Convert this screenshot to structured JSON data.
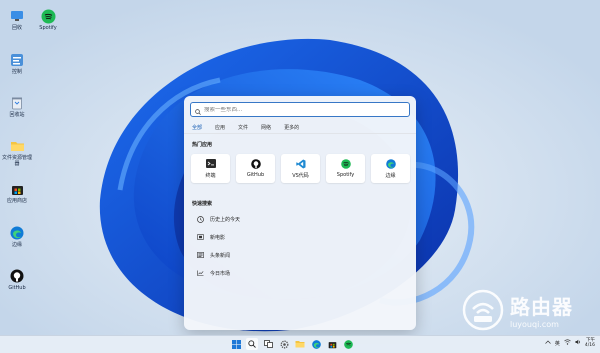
{
  "desktop": {
    "icons": [
      {
        "label": "回收",
        "icon": "pc-icon"
      },
      {
        "label": "Spotify",
        "icon": "spotify-icon"
      },
      {
        "label": "控制",
        "icon": "control-panel-icon"
      },
      {
        "label": "回收站",
        "icon": "recycle-bin-icon"
      },
      {
        "label": "文件资源管理器",
        "icon": "folder-icon"
      },
      {
        "label": "应用商店",
        "icon": "store-icon"
      },
      {
        "label": "边缘",
        "icon": "edge-icon"
      },
      {
        "label": "GitHub",
        "icon": "github-icon"
      }
    ]
  },
  "search": {
    "placeholder": "搜索一些东西..."
  },
  "tabs": [
    {
      "label": "全部"
    },
    {
      "label": "应用"
    },
    {
      "label": "文件"
    },
    {
      "label": "网络"
    },
    {
      "label": "更多的"
    }
  ],
  "apps_section": {
    "title": "热门应用",
    "apps": [
      {
        "label": "终端",
        "icon": "terminal-icon"
      },
      {
        "label": "GitHub",
        "icon": "github-icon"
      },
      {
        "label": "VS代码",
        "icon": "vscode-icon"
      },
      {
        "label": "Spotify",
        "icon": "spotify-icon"
      },
      {
        "label": "边缘",
        "icon": "edge-icon"
      }
    ]
  },
  "quick_section": {
    "title": "快速搜索",
    "items": [
      {
        "label": "历史上的今天",
        "icon": "clock-icon"
      },
      {
        "label": "新电影",
        "icon": "film-icon"
      },
      {
        "label": "头条新闻",
        "icon": "news-icon"
      },
      {
        "label": "今日市场",
        "icon": "chart-icon"
      }
    ]
  },
  "taskbar": {
    "tray_text": "英",
    "clock_time": "下午",
    "clock_date": "4/16"
  },
  "watermark": {
    "brand_cn": "路由器",
    "brand_url": "luyouqi.com"
  },
  "colors": {
    "accent": "#1a5fb4",
    "search_border": "#3777c6",
    "spotify": "#1db954",
    "edge": "#0f7bd6"
  }
}
